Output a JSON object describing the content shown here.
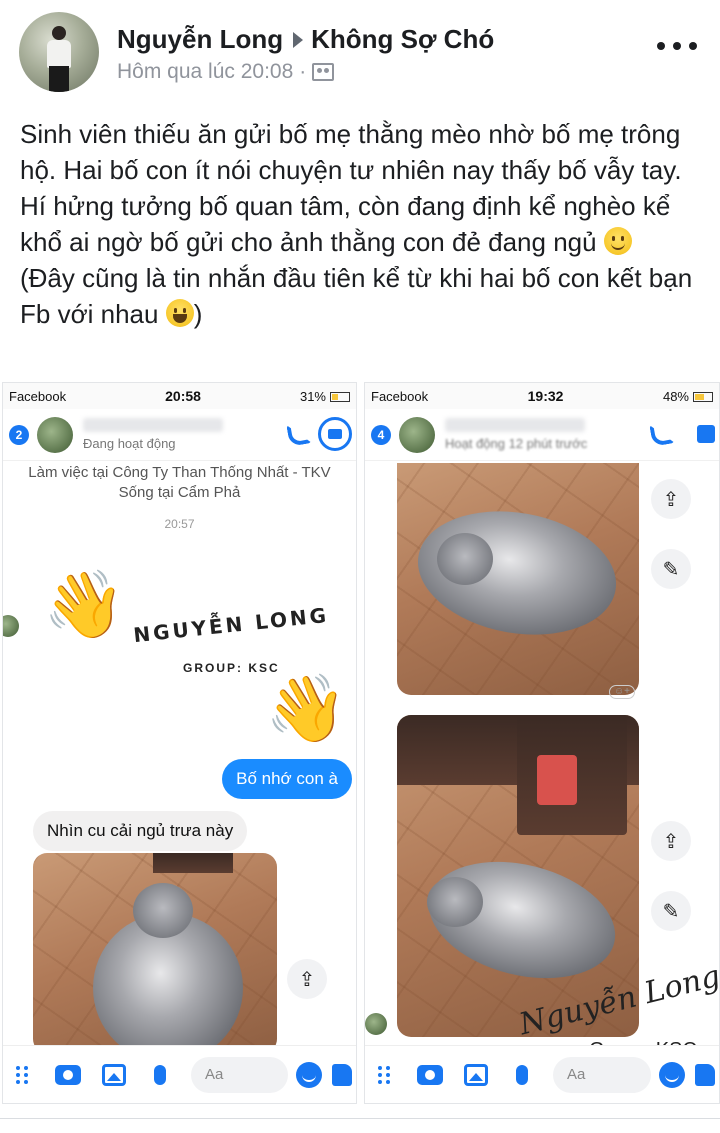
{
  "post": {
    "author": "Nguyễn Long",
    "group": "Không Sợ Chó",
    "time": "Hôm qua lúc 20:08",
    "dot": "·",
    "privacy_icon": "group-icon",
    "more_icon": "more-dots-icon",
    "body_line1": "Sinh viên thiếu ăn gửi bố mẹ thằng mèo nhờ bố mẹ trông hộ. Hai bố con ít nói chuyện tư nhiên nay thấy bố vẫy tay. Hí hửng tưởng bố quan tâm, còn đang định kể nghèo kể khổ ai ngờ bố gửi cho ảnh thằng con đẻ đang ngủ",
    "body_line2": "(Đây cũng là tin nhắn đầu tiên kể từ khi hai bố con kết bạn Fb với nhau",
    "body_end": ")",
    "emoji_1": "slight-smile-emoji",
    "emoji_2": "grin-emoji"
  },
  "left_shot": {
    "status_app": "Facebook",
    "status_time": "20:58",
    "status_battery": "31%",
    "battery_level": 0.31,
    "unread_badge": "2",
    "activity": "Đang hoạt động",
    "work_info": "Làm việc tại Công Ty Than Thống Nhất - TKV",
    "home_info": "Sống tại Cẩm Phả",
    "timestamp": "20:57",
    "watermark_name": "NGUYỄN LONG",
    "watermark_group": "GROUP: KSC",
    "wave_emoji": "👋",
    "out_message": "Bố nhớ con à",
    "in_message": "Nhìn cu cải ngủ trưa này",
    "share_icon": "⇪",
    "composer_placeholder": "Aa"
  },
  "right_shot": {
    "status_app": "Facebook",
    "status_time": "19:32",
    "status_battery": "48%",
    "battery_level": 0.48,
    "unread_badge": "4",
    "activity": "Hoạt động 12 phút trước",
    "share_icon": "⇪",
    "edit_icon": "✎",
    "react_icon": "☺+",
    "signature": "Nguyễn Long",
    "signature_group": "Group: KSC",
    "composer_placeholder": "Aa"
  }
}
